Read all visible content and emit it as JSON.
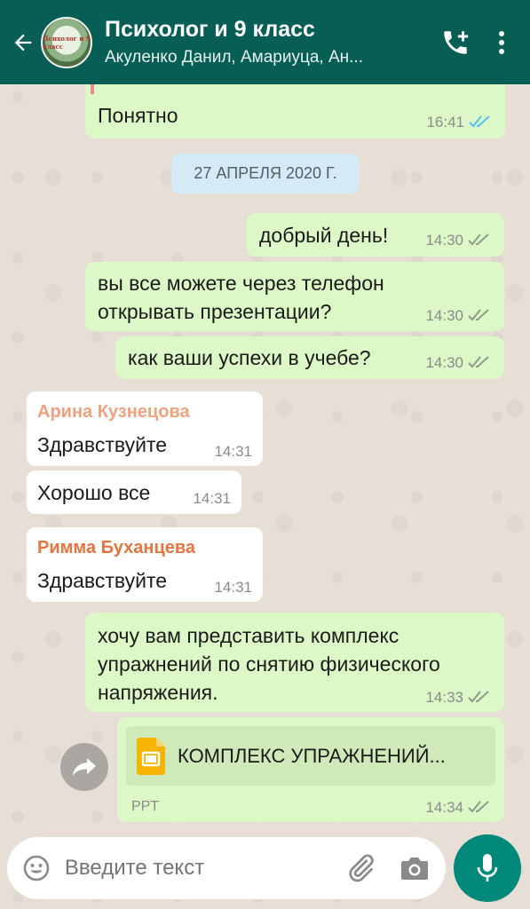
{
  "header": {
    "title": "Психолог и 9 класс",
    "subtitle": "Акуленко Данил, Амариуца, Ан...",
    "avatar_text": "Психолог и 9 класс"
  },
  "messages": {
    "m0": {
      "text": "Понятно",
      "time": "16:41"
    },
    "date": "27 АПРЕЛЯ 2020 Г.",
    "m1": {
      "text": "добрый день!",
      "time": "14:30"
    },
    "m2": {
      "text": "вы все можете через телефон открывать презентации?",
      "time": "14:30"
    },
    "m3": {
      "text": "как ваши успехи в учебе?",
      "time": "14:30"
    },
    "m4": {
      "sender": "Арина Кузнецова",
      "text": "Здравствуйте",
      "time": "14:31"
    },
    "m5": {
      "text": "Хорошо все",
      "time": "14:31"
    },
    "m6": {
      "sender": "Римма Буханцева",
      "text": "Здравствуйте",
      "time": "14:31"
    },
    "m7": {
      "text": "хочу вам представить комплекс упражнений по снятию физического напряжения.",
      "time": "14:33"
    },
    "m8": {
      "file_name": "КОМПЛЕКС УПРАЖНЕНИЙ...",
      "file_type": "PPT",
      "time": "14:34"
    }
  },
  "input": {
    "placeholder": "Введите текст"
  },
  "colors": {
    "header": "#075e54",
    "outgoing": "#dcf8c6",
    "incoming": "#ffffff",
    "sender1": "#f0a27e",
    "sender2": "#e8733f",
    "read_ticks": "#4fc3f7",
    "mic": "#00897b"
  }
}
